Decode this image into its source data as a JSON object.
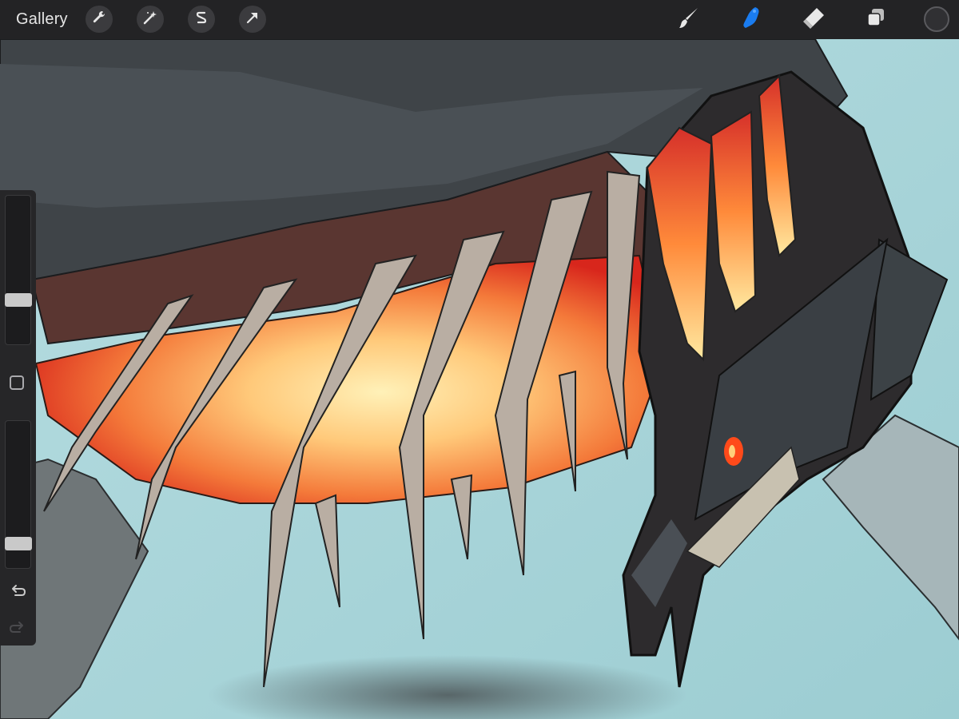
{
  "topbar": {
    "gallery_label": "Gallery",
    "left_tools": [
      {
        "name": "actions",
        "icon": "wrench-icon"
      },
      {
        "name": "adjustments",
        "icon": "magic-wand-icon"
      },
      {
        "name": "selection",
        "icon": "selection-s-icon"
      },
      {
        "name": "transform",
        "icon": "arrow-cursor-icon"
      }
    ],
    "right_tools": [
      {
        "name": "brush",
        "icon": "brush-icon",
        "active": false
      },
      {
        "name": "smudge",
        "icon": "smudge-finger-icon",
        "active": true
      },
      {
        "name": "eraser",
        "icon": "eraser-icon",
        "active": false
      },
      {
        "name": "layers",
        "icon": "layers-icon",
        "active": false
      }
    ],
    "current_color": "#303033",
    "accent_color": "#1a7cf0"
  },
  "sidebar": {
    "brush_size_level": 0.28,
    "opacity_level": 0.13,
    "undo_icon": "undo-icon",
    "redo_icon": "redo-icon"
  },
  "canvas": {
    "description_icon": "artwork-canvas"
  }
}
